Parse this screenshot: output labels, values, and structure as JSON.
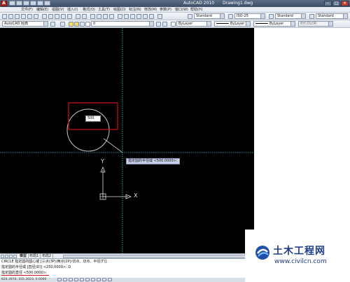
{
  "window": {
    "app_title": "AutoCAD 2010",
    "file_name": "Drawing1.dwg",
    "minimize_icon": "minimize-icon",
    "restore_icon": "restore-icon",
    "close_icon": "close-icon"
  },
  "menu": {
    "items": [
      "文件(F)",
      "编辑(E)",
      "视图(V)",
      "插入(I)",
      "格式(O)",
      "工具(T)",
      "绘图(D)",
      "标注(N)",
      "修改(M)",
      "参数(P)",
      "窗口(W)",
      "帮助(H)"
    ]
  },
  "toolbar": {
    "workspace": "AutoCAD 经典",
    "layer_value": "0",
    "text_style": "Standard",
    "dim_style": "ISO-25",
    "table_style": "Standard",
    "mleader_style": "Standard",
    "color": "ByLayer",
    "linetype": "ByLayer",
    "lineweight": "ByLayer",
    "plot_style": "BYCOLOR"
  },
  "drawing": {
    "dim_input_value": "500",
    "tooltip": "指定圆的半径或 <500.0000>:",
    "ucs_y": "Y",
    "ucs_x": "X",
    "colors": {
      "background": "#000000",
      "crosshair": "#4fc3d6",
      "circle": "#c8c8c8",
      "highlight_box": "#d01020"
    }
  },
  "layout_tabs": [
    "模型",
    "布局1",
    "布局2"
  ],
  "command_line": {
    "line1": "CIRCLE 指定圆的圆心或 [三点(3P)/两点(2P)/切点、切点、半径(T)]:",
    "line2": "指定圆的半径或 [直径(D)] <250.0000>: D",
    "line3": "指定圆的直径 <500.0000>:",
    "underline_color": "#d01020"
  },
  "status_bar": {
    "coords": "624.3976, 355.3023, 0.0000"
  },
  "watermark": {
    "brand": "土木工程网",
    "url": "www.civilcn.com"
  }
}
